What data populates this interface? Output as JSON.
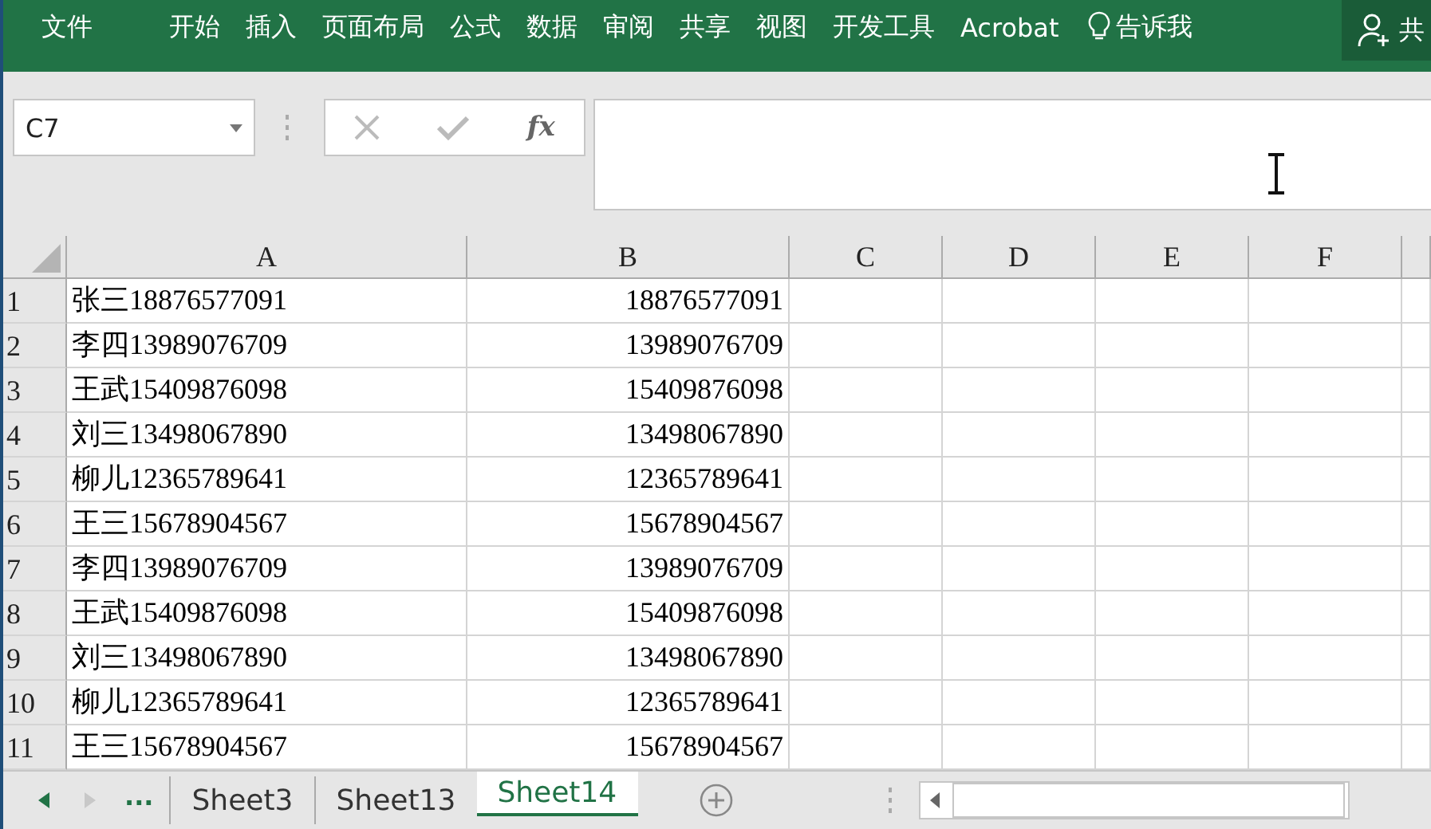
{
  "ribbon": {
    "tabs": [
      {
        "label": "文件"
      },
      {
        "label": "开始"
      },
      {
        "label": "插入"
      },
      {
        "label": "页面布局"
      },
      {
        "label": "公式"
      },
      {
        "label": "数据"
      },
      {
        "label": "审阅"
      },
      {
        "label": "共享"
      },
      {
        "label": "视图"
      },
      {
        "label": "开发工具"
      },
      {
        "label": "Acrobat"
      }
    ],
    "tell_me": "告诉我",
    "share": "共"
  },
  "formula_bar": {
    "name_box": "C7",
    "function_label": "fx"
  },
  "columns": [
    "A",
    "B",
    "C",
    "D",
    "E",
    "F"
  ],
  "rows": [
    {
      "number": "1",
      "cells": [
        "张三18876577091",
        "18876577091"
      ]
    },
    {
      "number": "2",
      "cells": [
        "李四13989076709",
        "13989076709"
      ]
    },
    {
      "number": "3",
      "cells": [
        "王武15409876098",
        "15409876098"
      ]
    },
    {
      "number": "4",
      "cells": [
        "刘三13498067890",
        "13498067890"
      ]
    },
    {
      "number": "5",
      "cells": [
        "柳儿12365789641",
        "12365789641"
      ]
    },
    {
      "number": "6",
      "cells": [
        "王三15678904567",
        "15678904567"
      ]
    },
    {
      "number": "7",
      "cells": [
        "李四13989076709",
        "13989076709"
      ]
    },
    {
      "number": "8",
      "cells": [
        "王武15409876098",
        "15409876098"
      ]
    },
    {
      "number": "9",
      "cells": [
        "刘三13498067890",
        "13498067890"
      ]
    },
    {
      "number": "10",
      "cells": [
        "柳儿12365789641",
        "12365789641"
      ]
    },
    {
      "number": "11",
      "cells": [
        "王三15678904567",
        "15678904567"
      ]
    }
  ],
  "sheet_bar": {
    "more": "...",
    "tabs": [
      {
        "label": "Sheet3",
        "selected": false
      },
      {
        "label": "Sheet13",
        "selected": false
      },
      {
        "label": "Sheet14",
        "selected": true
      }
    ]
  }
}
